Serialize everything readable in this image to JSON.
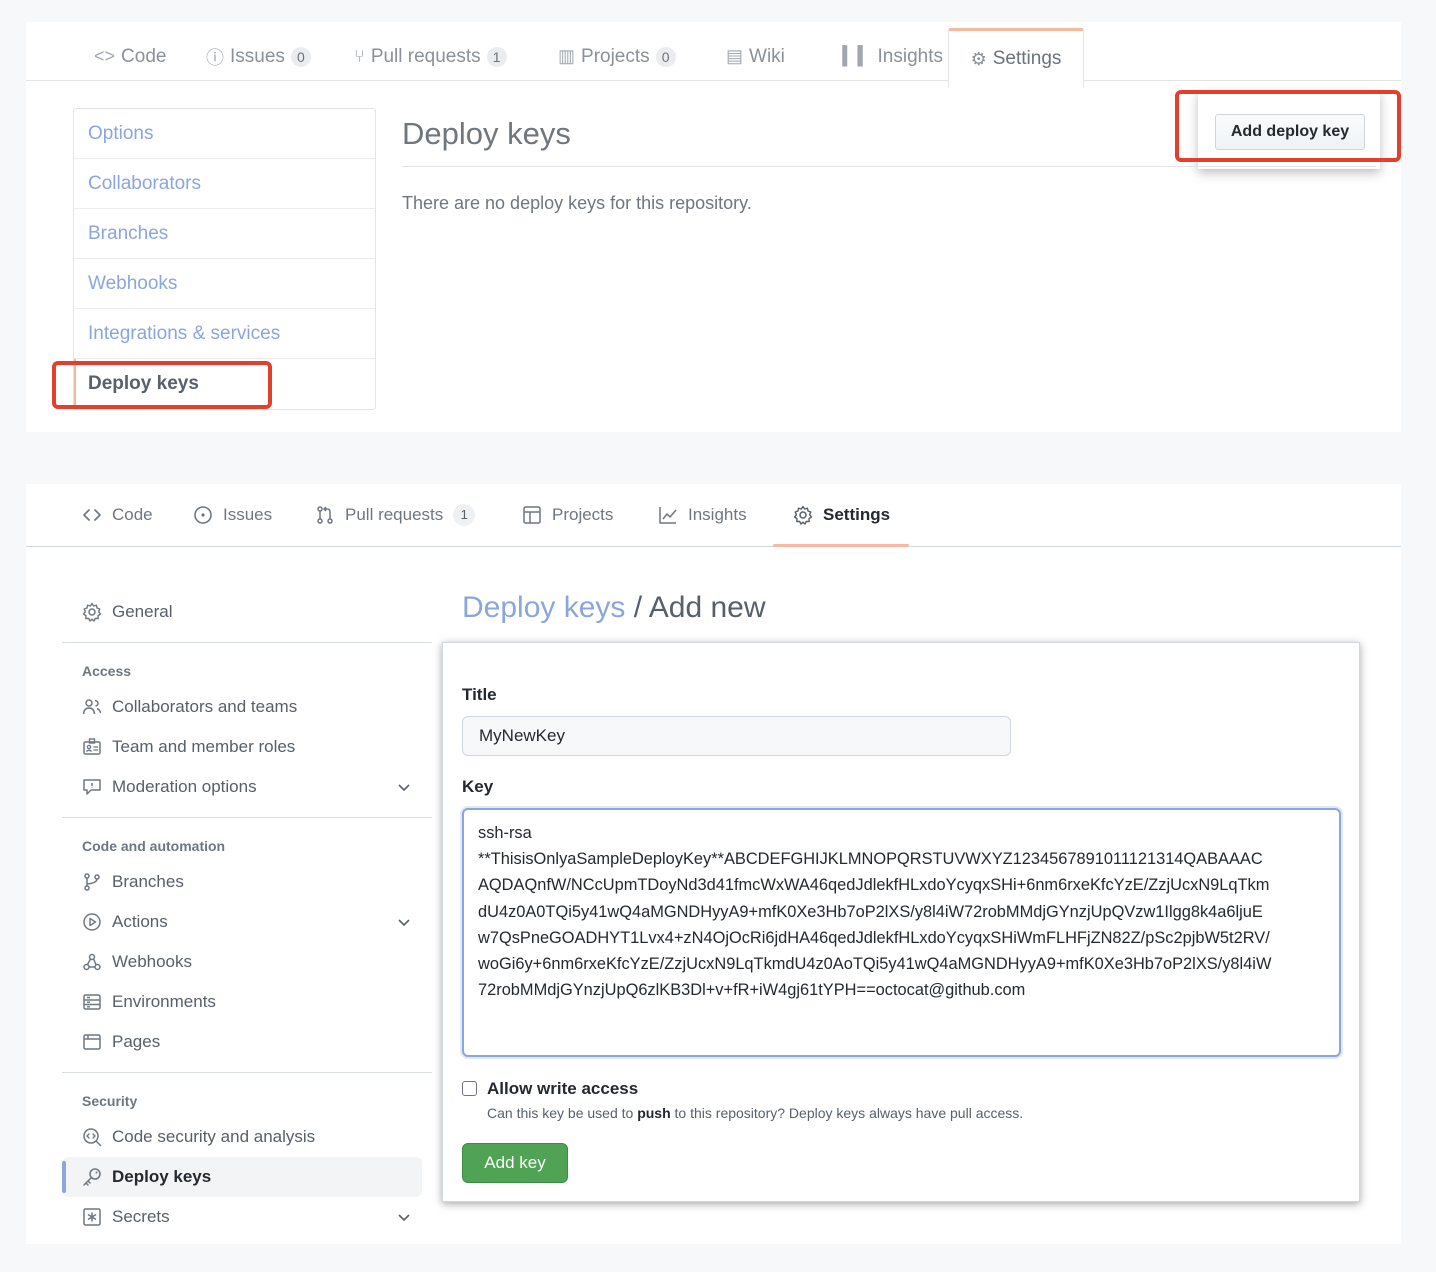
{
  "panel_old": {
    "tabs": [
      {
        "icon": "code-icon",
        "label": "Code",
        "count": null
      },
      {
        "icon": "issue-icon",
        "label": "Issues",
        "count": "0"
      },
      {
        "icon": "pull-request-icon",
        "label": "Pull requests",
        "count": "1"
      },
      {
        "icon": "project-icon",
        "label": "Projects",
        "count": "0"
      },
      {
        "icon": "wiki-icon",
        "label": "Wiki",
        "count": null
      },
      {
        "icon": "graph-icon",
        "label": "Insights",
        "count": null
      },
      {
        "icon": "gear-icon",
        "label": "Settings",
        "count": null,
        "selected": true
      }
    ],
    "menu": [
      "Options",
      "Collaborators",
      "Branches",
      "Webhooks",
      "Integrations & services",
      "Deploy keys"
    ],
    "active_menu": "Deploy keys",
    "heading": "Deploy keys",
    "add_button": "Add deploy key",
    "empty_message": "There are no deploy keys for this repository."
  },
  "panel_new": {
    "tabs": [
      {
        "icon": "code-icon",
        "label": "Code"
      },
      {
        "icon": "issue-opened-icon",
        "label": "Issues"
      },
      {
        "icon": "git-pull-request-icon",
        "label": "Pull requests",
        "count": "1"
      },
      {
        "icon": "table-icon",
        "label": "Projects"
      },
      {
        "icon": "graph-icon",
        "label": "Insights"
      },
      {
        "icon": "gear-icon",
        "label": "Settings",
        "selected": true
      }
    ],
    "sidebar": {
      "general": "General",
      "groups": [
        {
          "title": "Access",
          "items": [
            {
              "icon": "people-icon",
              "label": "Collaborators and teams"
            },
            {
              "icon": "id-badge-icon",
              "label": "Team and member roles"
            },
            {
              "icon": "report-icon",
              "label": "Moderation options",
              "expandable": true
            }
          ]
        },
        {
          "title": "Code and automation",
          "items": [
            {
              "icon": "git-branch-icon",
              "label": "Branches"
            },
            {
              "icon": "play-icon",
              "label": "Actions",
              "expandable": true
            },
            {
              "icon": "webhook-icon",
              "label": "Webhooks"
            },
            {
              "icon": "server-icon",
              "label": "Environments"
            },
            {
              "icon": "browser-icon",
              "label": "Pages"
            }
          ]
        },
        {
          "title": "Security",
          "items": [
            {
              "icon": "codescan-icon",
              "label": "Code security and analysis"
            },
            {
              "icon": "key-icon",
              "label": "Deploy keys",
              "active": true
            },
            {
              "icon": "key-asterisk-icon",
              "label": "Secrets",
              "expandable": true
            }
          ]
        }
      ]
    },
    "breadcrumb": {
      "link": "Deploy keys",
      "separator": " / ",
      "current": "Add new"
    },
    "form": {
      "title_label": "Title",
      "title_value": "MyNewKey",
      "key_label": "Key",
      "key_value": "ssh-rsa\n**ThisisOnlyaSampleDeployKey**ABCDEFGHIJKLMNOPQRSTUVWXYZ1234567891011121314QABAAAC\nAQDAQnfW/NCcUpmTDoyNd3d41fmcWxWA46qedJdlekfHLxdoYcyqxSHi+6nm6rxeKfcYzE/ZzjUcxN9LqTkm\ndU4z0A0TQi5y41wQ4aMGNDHyyA9+mfK0Xe3Hb7oP2lXS/y8l4iW72robMMdjGYnzjUpQVzw1Ilgg8k4a6ljuE\nw7QsPneGOADHYT1Lvx4+zN4OjOcRi6jdHA46qedJdlekfHLxdoYcyqxSHiWmFLHFjZN82Z/pSc2pjbW5t2RV/\nwoGi6y+6nm6rxeKfcYzE/ZzjUcxN9LqTkmdU4z0AoTQi5y41wQ4aMGNDHyyA9+mfK0Xe3Hb7oP2lXS/y8l4iW\n72robMMdjGYnzjUpQ6zlKB3Dl+v+fR+iW4gj61tYPH==octocat@github.com",
      "checkbox_label": "Allow write access",
      "checkbox_checked": false,
      "note_before": "Can this key be used to ",
      "note_bold": "push",
      "note_after": " to this repository? Deploy keys always have pull access.",
      "submit_label": "Add key"
    }
  },
  "colors": {
    "highlight": "#e0402c",
    "link": "#8aa6dd",
    "active_tab_accent": "#f3b99b",
    "primary_button": "#50a354"
  }
}
